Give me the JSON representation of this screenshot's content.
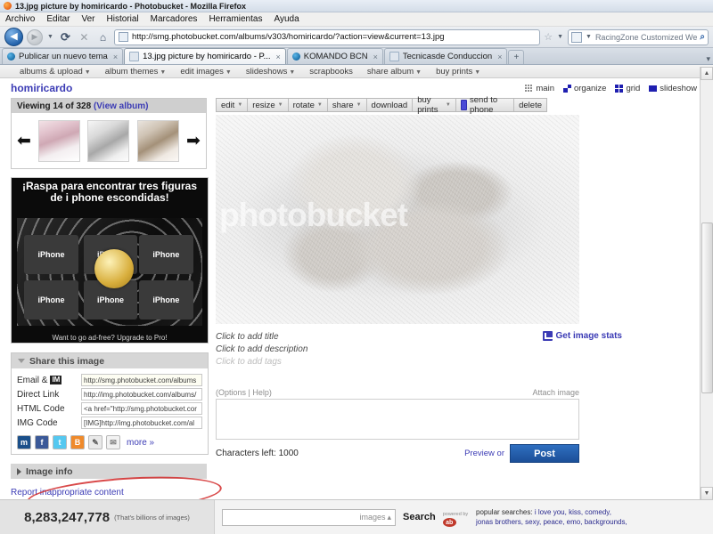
{
  "browser": {
    "window_title": "13.jpg picture by homiricardo - Photobucket - Mozilla Firefox",
    "menu": [
      "Archivo",
      "Editar",
      "Ver",
      "Historial",
      "Marcadores",
      "Herramientas",
      "Ayuda"
    ],
    "nav": {
      "back_icon": "back-arrow-icon",
      "forward_icon": "forward-arrow-icon",
      "reload_icon": "reload-icon",
      "stop_icon": "stop-icon",
      "home_icon": "home-icon",
      "url": "http://smg.photobucket.com/albums/v303/homiricardo/?action=view&current=13.jpg",
      "bookmark_icon": "star-icon",
      "search_placeholder": "RacingZone Customized Web Sec",
      "search_icon": "magnifier-icon"
    },
    "tabs": [
      {
        "label": "Publicar un nuevo tema",
        "active": false,
        "icon": "photobucket-icon"
      },
      {
        "label": "13.jpg picture by homiricardo - P...",
        "active": true,
        "icon": "generic-page-icon"
      },
      {
        "label": "KOMANDO BCN",
        "active": false,
        "icon": "photobucket-icon"
      },
      {
        "label": "Tecnicasde Conduccion",
        "active": false,
        "icon": "generic-page-icon"
      }
    ],
    "new_tab_label": "+",
    "tab_list_label": "▾",
    "tab_close_label": "×"
  },
  "site_nav": [
    {
      "label": "albums & upload",
      "caret": true
    },
    {
      "label": "album themes",
      "caret": true
    },
    {
      "label": "edit images",
      "caret": true
    },
    {
      "label": "slideshows",
      "caret": true
    },
    {
      "label": "scrapbooks",
      "caret": false
    },
    {
      "label": "share album",
      "caret": true
    },
    {
      "label": "buy prints",
      "caret": true
    }
  ],
  "header": {
    "username": "homiricardo",
    "view_modes": [
      {
        "label": "main",
        "icon": "grid-dots-icon"
      },
      {
        "label": "organize",
        "icon": "organize-icon"
      },
      {
        "label": "grid",
        "icon": "grid-icon"
      },
      {
        "label": "slideshow",
        "icon": "slideshow-icon"
      }
    ]
  },
  "sidebar": {
    "viewing": {
      "text": "Viewing 14 of 328",
      "view_album_label": "(View album)",
      "prev_icon": "left-arrow-icon",
      "next_icon": "right-arrow-icon",
      "thumbs": [
        "thumbnail-baby-hat",
        "thumbnail-baby-bw",
        "thumbnail-baby-sleeping"
      ]
    },
    "ad": {
      "headline": "¡Raspa para encontrar tres figuras de i phone escondidas!",
      "tiles": [
        "iPhone",
        "iPhone",
        "iPhone",
        "iPhone",
        "iPhone",
        "iPhone"
      ],
      "footer": "Want to go ad-free? Upgrade to Pro!"
    },
    "share_panel": {
      "title": "Share this image",
      "collapse_icon": "triangle-down-icon",
      "rows": [
        {
          "label": "Email & ",
          "badge": "IM",
          "value": "http://smg.photobucket.com/albums"
        },
        {
          "label": "Direct Link",
          "badge": "",
          "value": "http://img.photobucket.com/albums/"
        },
        {
          "label": "HTML Code",
          "badge": "",
          "value": "<a href=\"http://smg.photobucket.cor"
        },
        {
          "label": "IMG Code",
          "badge": "",
          "value": "[IMG]http://img.photobucket.com/al"
        }
      ],
      "icons": [
        {
          "name": "myspace-icon",
          "glyph": "m"
        },
        {
          "name": "facebook-icon",
          "glyph": "f"
        },
        {
          "name": "twitter-icon",
          "glyph": "t"
        },
        {
          "name": "blogger-icon",
          "glyph": "B"
        },
        {
          "name": "link-icon",
          "glyph": "✎"
        },
        {
          "name": "email-icon",
          "glyph": "✉"
        }
      ],
      "more_label": "more »"
    },
    "image_info": {
      "title": "Image info",
      "expand_icon": "triangle-right-icon"
    },
    "report_link": "Report inappropriate content"
  },
  "image_toolbar": [
    {
      "label": "edit",
      "caret": true
    },
    {
      "label": "resize",
      "caret": true
    },
    {
      "label": "rotate",
      "caret": true
    },
    {
      "label": "share",
      "caret": true
    },
    {
      "label": "download",
      "caret": false
    },
    {
      "label": "buy prints",
      "caret": true
    },
    {
      "label": "send to phone",
      "caret": false,
      "icon": "phone-icon"
    },
    {
      "label": "delete",
      "caret": false
    }
  ],
  "main_image": {
    "alt": "sleeping-baby-photo",
    "watermark": "photobucket"
  },
  "meta": {
    "title_prompt": "Click to add title",
    "description_prompt": "Click to add description",
    "tags_prompt": "Click to add tags",
    "stats_label": "Get image stats",
    "stats_icon": "chart-icon"
  },
  "comment": {
    "options_help": "(Options | Help)",
    "attach_label": "Attach image",
    "textarea_value": "",
    "chars_left": "Characters left: 1000",
    "preview_label": "Preview or",
    "post_label": "Post"
  },
  "footer": {
    "count": "8,283,247,778",
    "count_note": "(That's billions of images)",
    "search_value": "",
    "search_scope": "images",
    "scope_caret": "▴",
    "search_button": "Search",
    "powered_by": "powered by",
    "powered_brand": "ab",
    "popular_label": "popular searches:",
    "popular_line1": "i love you, kiss, comedy,",
    "popular_line2": "jonas brothers, sexy, peace, emo, backgrounds,"
  },
  "scrollbar": {
    "up_icon": "scroll-up-icon",
    "down_icon": "scroll-down-icon"
  },
  "colors": {
    "brand_blue": "#3b3bb5",
    "post_blue": "#1c4f98",
    "ink_red": "#d22a2a"
  }
}
